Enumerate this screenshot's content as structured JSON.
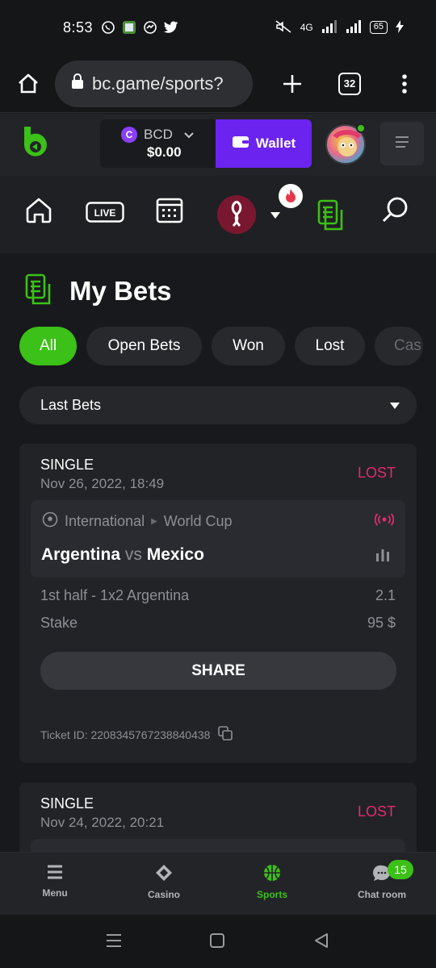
{
  "status_bar": {
    "time": "8:53",
    "left_icons": [
      "whatsapp-icon",
      "photos-icon",
      "messenger-icon",
      "twitter-icon"
    ],
    "network": "4G",
    "battery": "65"
  },
  "browser": {
    "url": "bc.game/sports?",
    "tab_count": "32"
  },
  "header": {
    "currency_code": "BCD",
    "balance": "$0.00",
    "wallet_label": "Wallet",
    "accent_color": "#6b23f0"
  },
  "sports_nav": {
    "items": [
      "home-icon",
      "live-icon",
      "calendar-icon",
      "world-cup-icon",
      "fire-badge-icon",
      "my-bets-icon",
      "search-icon"
    ],
    "live_label": "LIVE"
  },
  "page": {
    "title": "My Bets",
    "filters": [
      "All",
      "Open Bets",
      "Won",
      "Lost",
      "Cas"
    ],
    "active_filter": "All",
    "sort_label": "Last Bets"
  },
  "bets": [
    {
      "type": "SINGLE",
      "date": "Nov 26, 2022, 18:49",
      "status": "LOST",
      "sport_icon": "soccer-ball-icon",
      "league": "International",
      "tournament": "World Cup",
      "team_home": "Argentina",
      "vs": "vs",
      "team_away": "Mexico",
      "market": "1st half - 1x2 Argentina",
      "odds": "2.1",
      "stake_label": "Stake",
      "stake_value": "95 $",
      "share_label": "SHARE",
      "ticket_label": "Ticket ID: 2208345767238840438"
    },
    {
      "type": "SINGLE",
      "date": "Nov 24, 2022, 20:21",
      "status": "LOST"
    }
  ],
  "tabbar": {
    "items": [
      {
        "label": "Menu",
        "icon": "menu-icon"
      },
      {
        "label": "Casino",
        "icon": "casino-icon"
      },
      {
        "label": "Sports",
        "icon": "sports-icon"
      },
      {
        "label": "Chat room",
        "icon": "chat-icon"
      }
    ],
    "active": "Sports",
    "chat_badge": "15"
  },
  "colors": {
    "green": "#3bc117",
    "lost": "#e52a6f",
    "purple": "#6b23f0"
  }
}
